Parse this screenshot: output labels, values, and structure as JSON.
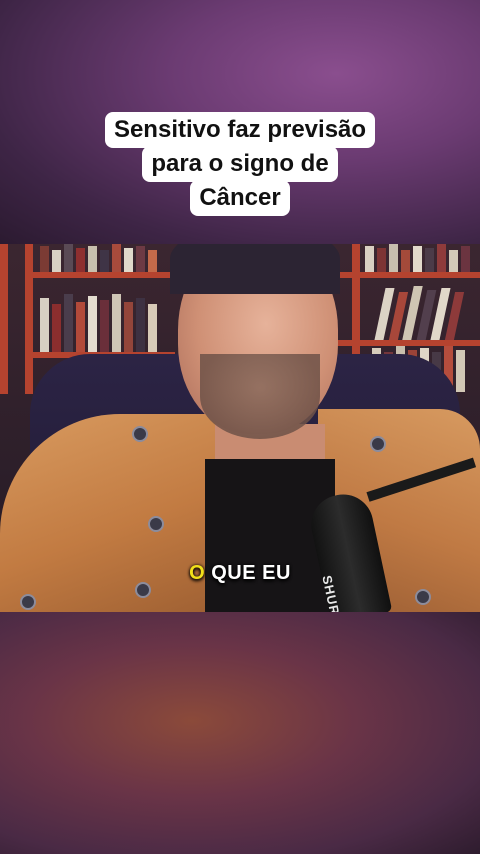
{
  "headline": {
    "lines": [
      "Sensitivo faz previsão",
      "para o signo de",
      "Câncer"
    ]
  },
  "caption": {
    "highlight_word": "O",
    "rest": "QUE EU"
  },
  "mic": {
    "brand": "SHURE"
  },
  "colors": {
    "headline_bg": "#ffffff",
    "caption_highlight": "#f2df1a",
    "caption_text": "#ffffff"
  }
}
